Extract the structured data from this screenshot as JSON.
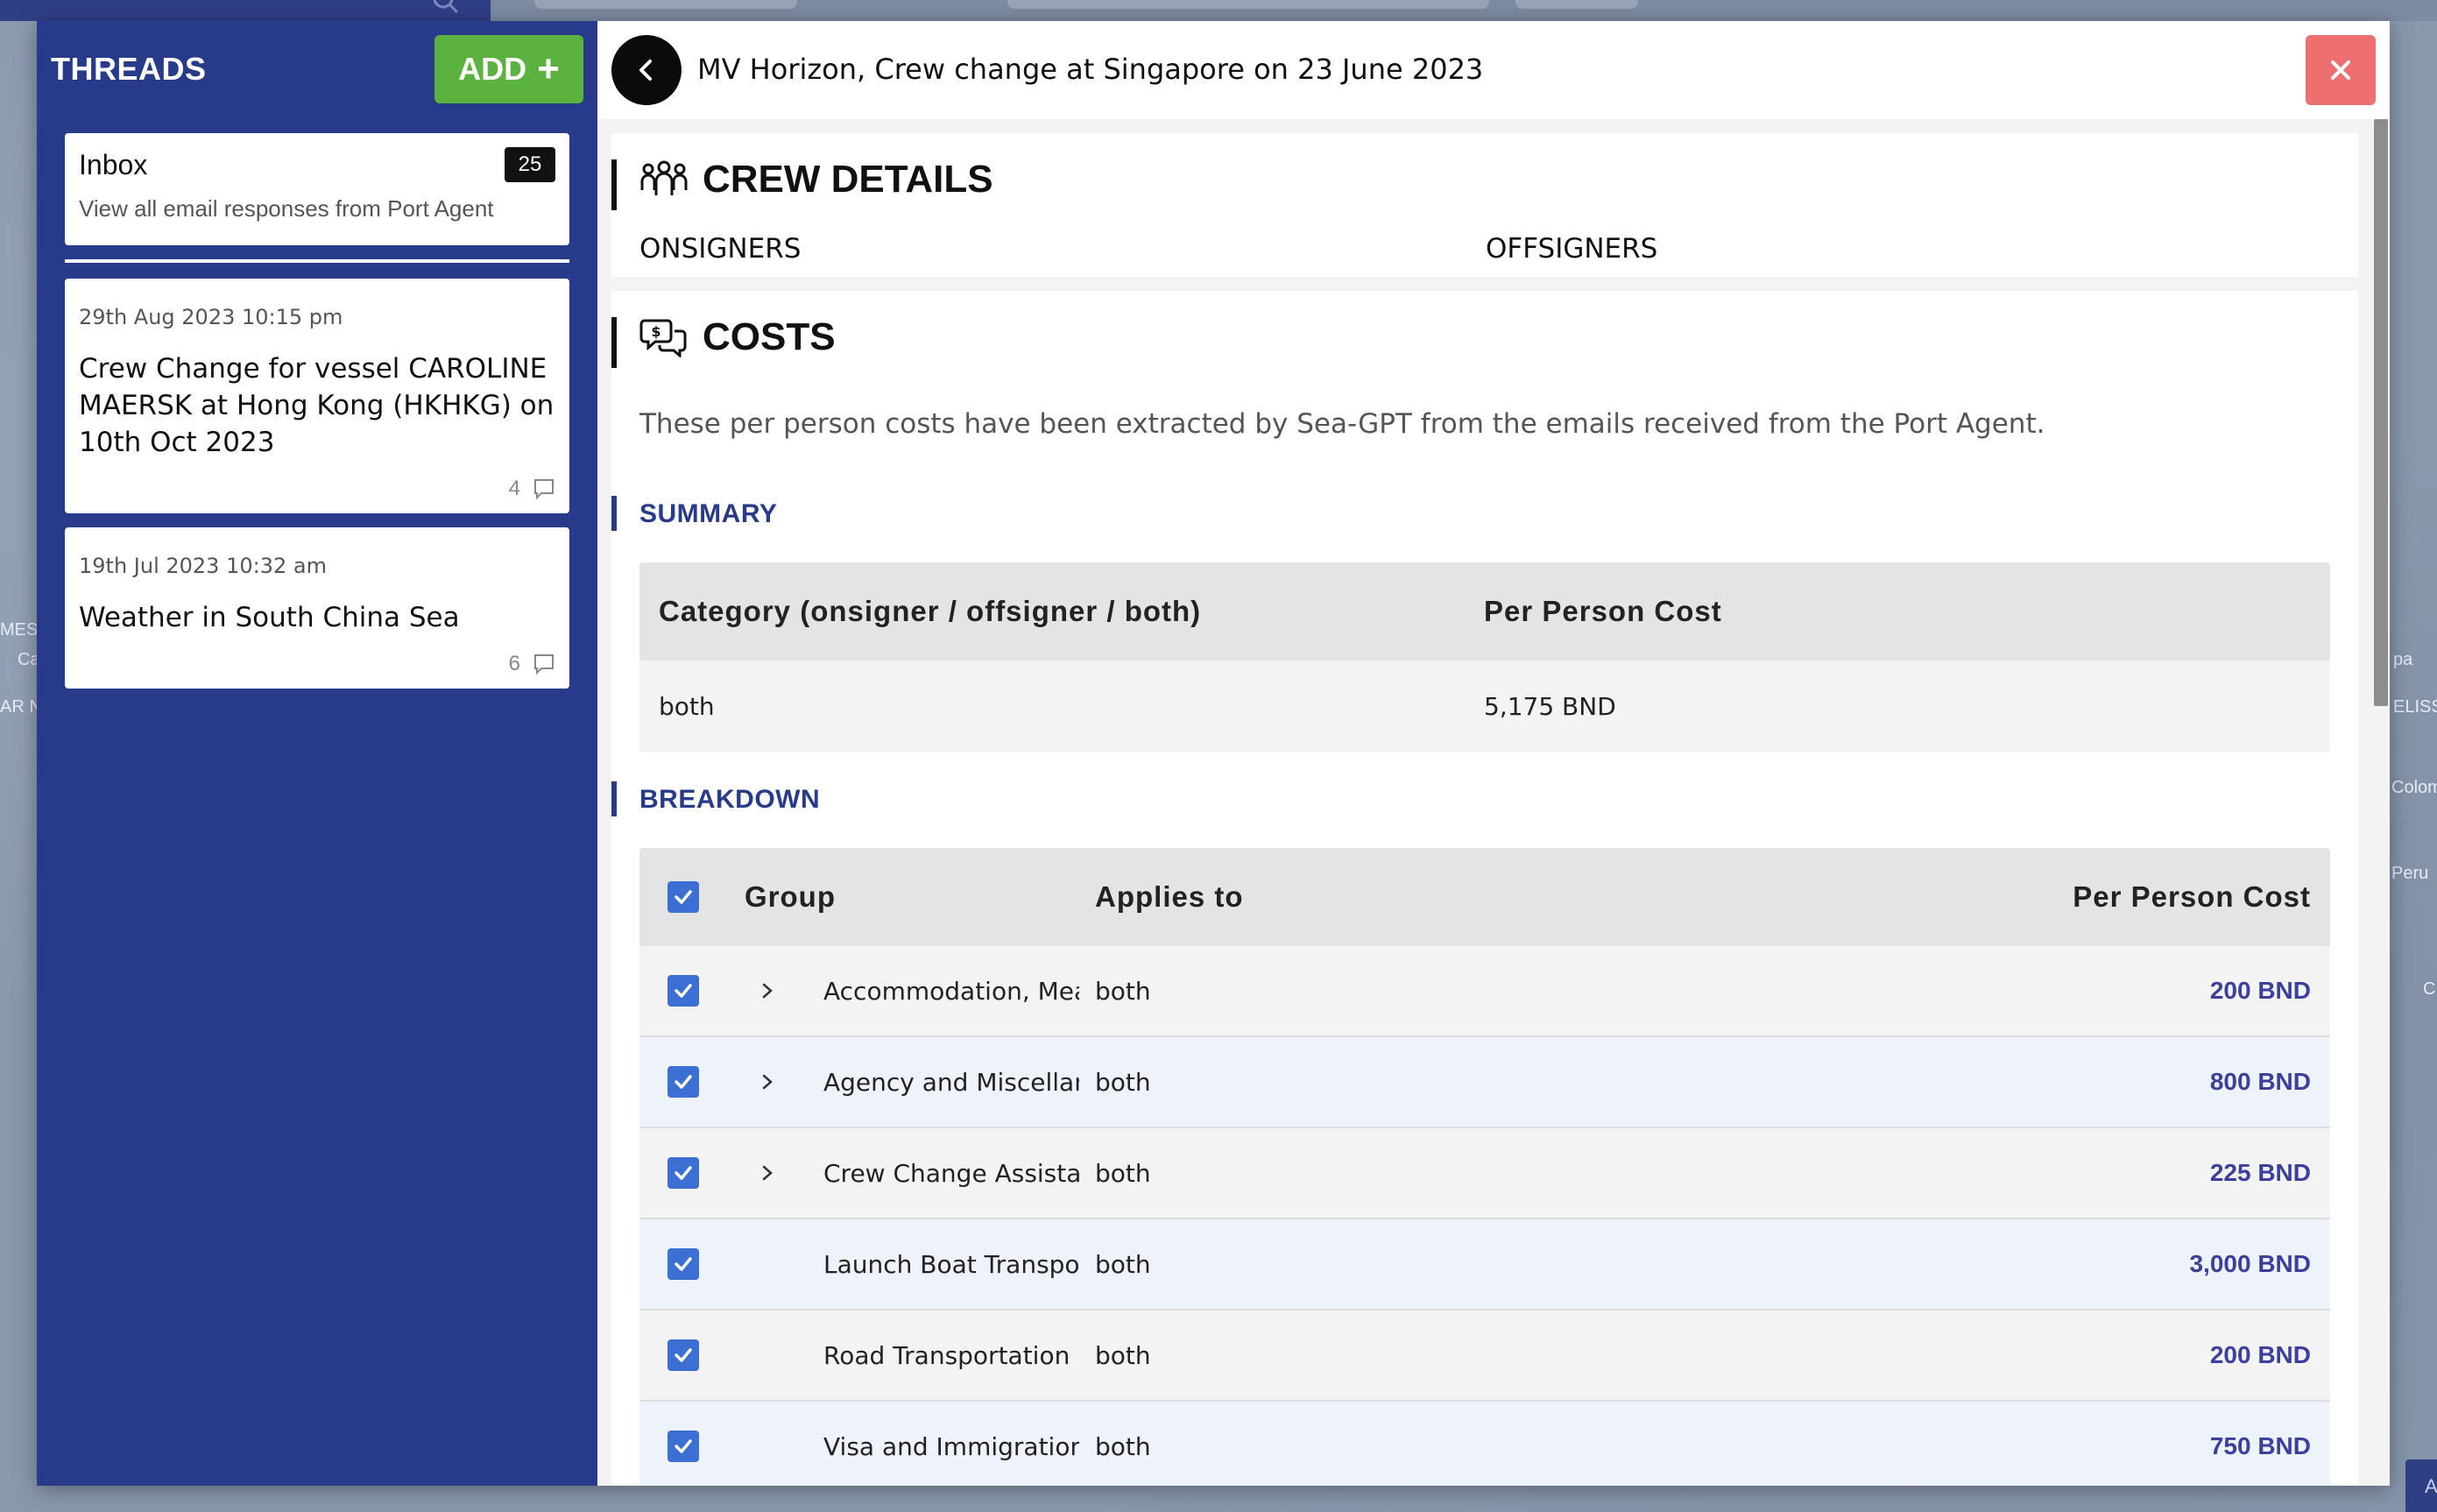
{
  "background": {
    "edge_labels": [
      "MES",
      "Ca",
      "AR N",
      "pa",
      "ELISS",
      "Colom",
      "Peru",
      "C",
      "A"
    ]
  },
  "sidebar": {
    "title": "THREADS",
    "add_label": "ADD",
    "inbox": {
      "title": "Inbox",
      "count": "25",
      "subtitle": "View all email responses from Port Agent"
    },
    "threads": [
      {
        "date": "29th Aug 2023 10:15 pm",
        "title": "Crew Change for vessel CAROLINE MAERSK at Hong Kong (HKHKG) on 10th Oct 2023",
        "comments": "4"
      },
      {
        "date": "19th Jul 2023 10:32 am",
        "title": "Weather in South China Sea",
        "comments": "6"
      }
    ]
  },
  "header": {
    "title": "MV Horizon, Crew change at Singapore on 23 June 2023"
  },
  "crew_details": {
    "heading": "CREW DETAILS",
    "onsigners_label": "ONSIGNERS",
    "offsigners_label": "OFFSIGNERS"
  },
  "costs": {
    "heading": "COSTS",
    "description": "These per person costs have been extracted by Sea-GPT from the emails received from the Port Agent.",
    "summary": {
      "heading": "SUMMARY",
      "columns": [
        "Category (onsigner / offsigner / both)",
        "Per Person Cost"
      ],
      "rows": [
        {
          "category": "both",
          "cost": "5,175 BND"
        }
      ]
    },
    "breakdown": {
      "heading": "BREAKDOWN",
      "columns": {
        "group": "Group",
        "applies_to": "Applies to",
        "cost": "Per Person Cost"
      },
      "rows": [
        {
          "group": "Accommodation, Meals",
          "applies_to": "both",
          "cost": "200 BND",
          "expandable": true,
          "checked": true
        },
        {
          "group": "Agency and Miscellaneous",
          "applies_to": "both",
          "cost": "800 BND",
          "expandable": true,
          "checked": true
        },
        {
          "group": "Crew Change Assistance",
          "applies_to": "both",
          "cost": "225 BND",
          "expandable": true,
          "checked": true
        },
        {
          "group": "Launch Boat Transportation",
          "applies_to": "both",
          "cost": "3,000 BND",
          "expandable": false,
          "checked": true
        },
        {
          "group": "Road Transportation",
          "applies_to": "both",
          "cost": "200 BND",
          "expandable": false,
          "checked": true
        },
        {
          "group": "Visa and Immigration",
          "applies_to": "both",
          "cost": "750 BND",
          "expandable": false,
          "checked": true
        }
      ]
    }
  },
  "colors": {
    "sidebar_bg": "#283a8a",
    "add_button": "#5cb23e",
    "close_button": "#ee6f6f",
    "checkbox": "#3b6fd4",
    "cost_text": "#3c3f9e"
  }
}
